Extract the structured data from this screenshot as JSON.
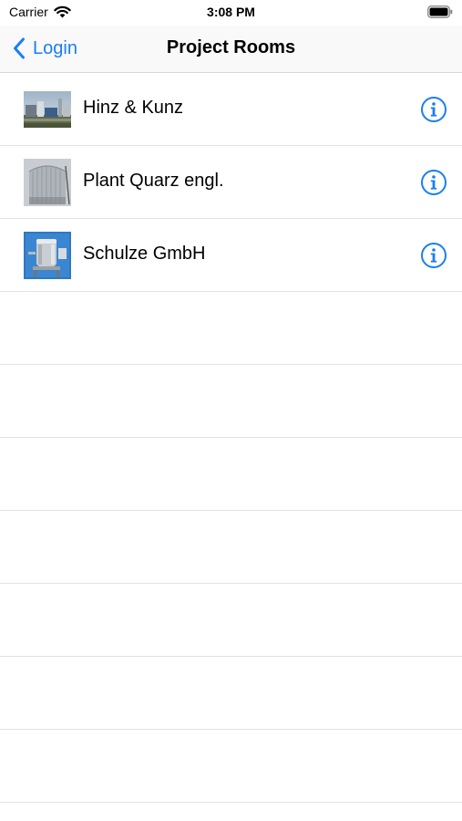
{
  "status_bar": {
    "carrier": "Carrier",
    "time": "3:08 PM"
  },
  "nav": {
    "back_label": "Login",
    "title": "Project Rooms"
  },
  "rooms": [
    {
      "label": "Hinz & Kunz"
    },
    {
      "label": "Plant Quarz engl."
    },
    {
      "label": "Schulze GmbH"
    }
  ],
  "colors": {
    "accent": "#1a7ff2"
  },
  "icons": {
    "wifi": "wifi-icon",
    "battery": "battery-icon",
    "back": "chevron-left-icon",
    "info": "info-circle-icon"
  }
}
